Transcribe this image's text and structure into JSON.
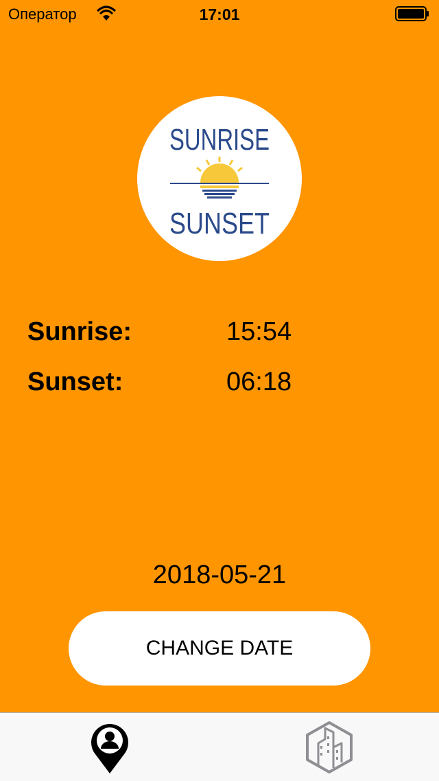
{
  "status_bar": {
    "carrier": "Оператор",
    "time": "17:01"
  },
  "logo": {
    "line1": "SUNRISE",
    "line2": "SUNSET"
  },
  "times": {
    "sunrise_label": "Sunrise:",
    "sunrise_value": "15:54",
    "sunset_label": "Sunset:",
    "sunset_value": "06:18"
  },
  "date": "2018-05-21",
  "change_date_button": "CHANGE DATE",
  "tab_bar": {
    "active_tab": "location-pin-icon",
    "tabs": [
      "location-pin-icon",
      "city-buildings-icon"
    ]
  },
  "colors": {
    "background": "#FF9500",
    "logo_text": "#2B4A8B",
    "sun": "#F6C83A"
  }
}
